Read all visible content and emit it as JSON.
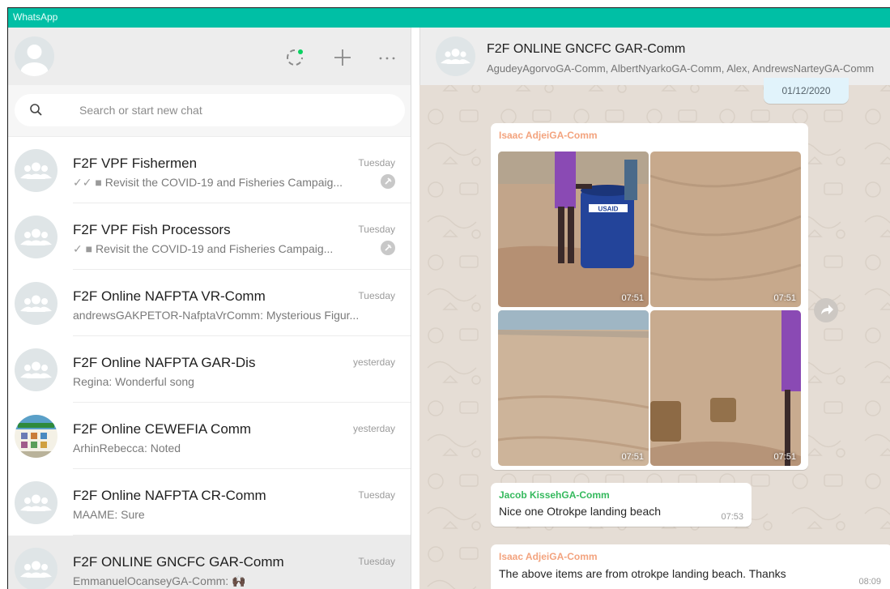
{
  "window": {
    "title": "WhatsApp",
    "accent": "#00bfa5"
  },
  "left_header": {
    "status_icon": "status-icon",
    "new_chat_icon": "plus-icon",
    "menu_icon": "ellipsis-icon"
  },
  "search": {
    "placeholder": "Search or start new chat",
    "value": ""
  },
  "chats": [
    {
      "name": "F2F VPF Fishermen",
      "time": "Tuesday",
      "prefix": "✓✓ ■",
      "message": "Revisit the COVID-19 and Fisheries Campaig...",
      "pinned": true
    },
    {
      "name": "F2F VPF Fish Processors",
      "time": "Tuesday",
      "prefix": "✓ ■",
      "message": "Revisit the COVID-19 and Fisheries Campaig...",
      "pinned": true
    },
    {
      "name": "F2F Online NAFPTA VR-Comm",
      "time": "Tuesday",
      "prefix": "",
      "message": "andrewsGAKPETOR-NafptaVrComm: Mysterious Figur...",
      "pinned": false
    },
    {
      "name": "F2F Online NAFPTA GAR-Dis",
      "time": "yesterday",
      "prefix": "",
      "message": "Regina: Wonderful song",
      "pinned": false
    },
    {
      "name": "F2F Online CEWEFIA Comm",
      "time": "yesterday",
      "prefix": "",
      "message": "ArhinRebecca: Noted",
      "pinned": false
    },
    {
      "name": "F2F Online NAFPTA CR-Comm",
      "time": "Tuesday",
      "prefix": "",
      "message": "MAAME: Sure",
      "pinned": false
    },
    {
      "name": "F2F ONLINE GNCFC GAR-Comm",
      "time": "Tuesday",
      "prefix": "",
      "message": "EmmanuelOcanseyGA-Comm: 🙌🏿",
      "pinned": false
    }
  ],
  "conversation": {
    "name": "F2F ONLINE GNCFC GAR-Comm",
    "members": "AgudeyAgorvoGA-Comm, AlbertNyarkoGA-Comm, Alex, AndrewsNarteyGA-Comm",
    "date_chip": "01/12/2020",
    "photo_message": {
      "sender": "Isaac AdjeiGA-Comm",
      "sender_color": "#f3a37e",
      "photo_times": [
        "07:51",
        "07:51",
        "07:51",
        "07:51"
      ],
      "barrel_logo": "USAID"
    },
    "messages": [
      {
        "sender": "Jacob KissehGA-Comm",
        "sender_color": "#35b95d",
        "text": "Nice one Otrokpe landing beach",
        "time": "07:53"
      },
      {
        "sender": "Isaac AdjeiGA-Comm",
        "sender_color": "#f3a37e",
        "text": "The above items are from otrokpe landing beach. Thanks",
        "time": "08:09"
      }
    ]
  }
}
